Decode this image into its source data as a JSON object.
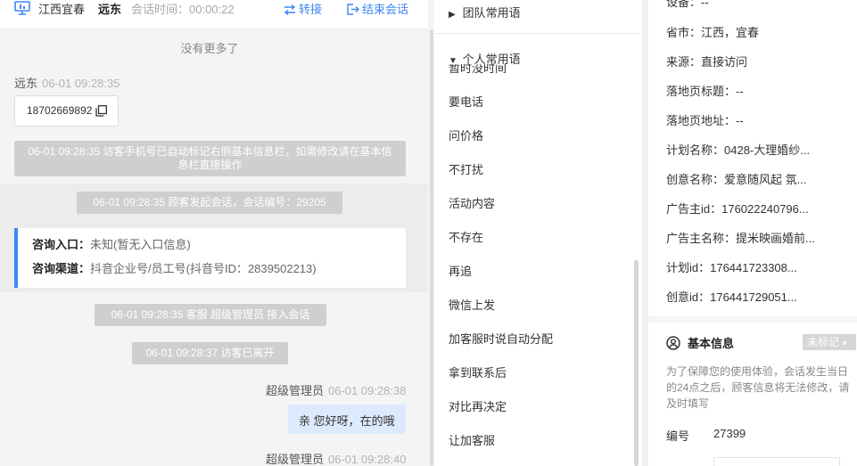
{
  "header": {
    "region": "江西宜春",
    "visitor": "远东",
    "session_time": "会话时间：00:00:22",
    "transfer_label": "转接",
    "end_label": "结束会话"
  },
  "chat": {
    "no_more": "没有更多了",
    "visitor_name": "远东",
    "visitor_ts": "06-01 09:28:35",
    "phone": "18702669892",
    "sys1": "06-01 09:28:35 访客手机号已自动标记右侧基本信息栏，如需修改请在基本信息栏直接操作",
    "sys2": "06-01 09:28:35 顾客发起会话，会话编号：29205",
    "entry_key": "咨询入口：",
    "entry_val": "未知(暂无入口信息)",
    "channel_key": "咨询渠道：",
    "channel_val": "抖音企业号/员工号(抖音号ID：2839502213)",
    "sys3": "06-01 09:28:35 客服 超级管理员 接入会话",
    "sys4": "06-01 09:28:37 访客已离开",
    "agent_name_1": "超级管理员",
    "agent_ts_1": "06-01 09:28:38",
    "agent_msg_1": "亲 您好呀，在的哦",
    "agent_name_2": "超级管理员",
    "agent_ts_2": "06-01 09:28:40"
  },
  "phrases": {
    "team_group": "团队常用语",
    "personal_group": "个人常用语",
    "cut_item": "暂时没时间",
    "items": [
      "要电话",
      "问价格",
      "不打扰",
      "活动内容",
      "不存在",
      "再追",
      "微信上发",
      "加客服时说自动分配",
      "拿到联系后",
      "对比再决定",
      "让加客服"
    ]
  },
  "info": {
    "device": "设备：--",
    "province": "省市：江西，宜春",
    "source": "来源：直接访问",
    "landing_title": "落地页标题：--",
    "landing_url": "落地页地址：--",
    "plan_name": "计划名称：0428-大理婚纱...",
    "creative_name": "创意名称：爱意随风起 氛...",
    "advertiser_id": "广告主id：176022240796...",
    "advertiser_name": "广告主名称：提米映画婚前...",
    "plan_id": "计划id：176441723308...",
    "creative_id": "创意id：176441729051...",
    "section_title": "基本信息",
    "tag_label": "未标记",
    "note": "为了保障您的使用体验，会话发生当日的24点之后，顾客信息将无法修改，请及时填写",
    "id_label": "编号",
    "id_value": "27399"
  },
  "colors": {
    "accent": "#3d86f5",
    "system_pill": "#cfcfcf",
    "agent_bubble": "#dceafe"
  }
}
